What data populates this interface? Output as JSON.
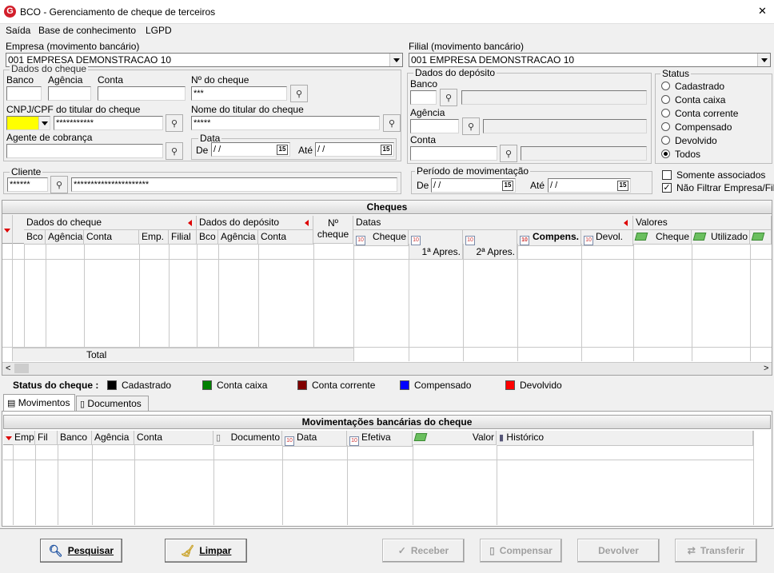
{
  "window": {
    "title": "BCO - Gerenciamento de cheque de terceiros",
    "close": "✕"
  },
  "menu": [
    "Saída",
    "Base de conhecimento",
    "LGPD"
  ],
  "empresa": {
    "label": "Empresa (movimento bancário)",
    "value": "001 EMPRESA DEMONSTRACAO 10"
  },
  "filial": {
    "label": "Filial (movimento bancário)",
    "value": "001 EMPRESA DEMONSTRACAO 10"
  },
  "dados_cheque": {
    "title": "Dados do cheque",
    "banco": "Banco",
    "agencia": "Agência",
    "conta": "Conta",
    "numero": "Nº do cheque",
    "numero_value": "***",
    "cnpj": "CNPJ/CPF do titular do cheque",
    "cnpj_value": "***********",
    "nome": "Nome do titular do cheque",
    "nome_value": "*****",
    "agente": "Agente de cobrança",
    "data": "Data",
    "de": "De",
    "ate": "Até",
    "date_placeholder": " /  /"
  },
  "dados_deposito": {
    "title": "Dados do depósito",
    "banco": "Banco",
    "agencia": "Agência",
    "conta": "Conta"
  },
  "status": {
    "title": "Status",
    "options": [
      "Cadastrado",
      "Conta caixa",
      "Conta corrente",
      "Compensado",
      "Devolvido",
      "Todos"
    ],
    "selected": "Todos"
  },
  "cliente": {
    "label": "Cliente",
    "code": "******",
    "name": "**********************"
  },
  "periodo": {
    "title": "Período de movimentação",
    "de": "De",
    "ate": "Até",
    "date_placeholder": " /  /"
  },
  "checks": {
    "somente": "Somente associados",
    "nao_filtrar": "Não Filtrar Empresa/Filial",
    "nao_filtrar_checked": true
  },
  "cheques_grid": {
    "title": "Cheques",
    "group_dados_cheque": "Dados do cheque",
    "group_dados_deposito": "Dados do depósito",
    "group_n_cheque": "Nº cheque",
    "group_datas": "Datas",
    "group_valores": "Valores",
    "cols_cheque": [
      "Bco",
      "Agência",
      "Conta",
      "Emp.",
      "Filial"
    ],
    "cols_deposito": [
      "Bco",
      "Agência",
      "Conta"
    ],
    "cols_datas": [
      "Cheque",
      "1ª Apres.",
      "2ª Apres.",
      "Compens.",
      "Devol."
    ],
    "cols_valores": [
      "Cheque",
      "Utilizado"
    ],
    "total": "Total"
  },
  "legend": {
    "label": "Status do cheque :",
    "items": [
      {
        "name": "Cadastrado",
        "color": "#000000"
      },
      {
        "name": "Conta caixa",
        "color": "#008000"
      },
      {
        "name": "Conta corrente",
        "color": "#800000"
      },
      {
        "name": "Compensado",
        "color": "#0000ff"
      },
      {
        "name": "Devolvido",
        "color": "#ff0000"
      }
    ]
  },
  "tabs": [
    "Movimentos",
    "Documentos"
  ],
  "mov_grid": {
    "title": "Movimentações bancárias do cheque",
    "cols": [
      "Emp",
      "Fil",
      "Banco",
      "Agência",
      "Conta",
      "Documento",
      "Data",
      "Efetiva",
      "Valor",
      "Histórico"
    ]
  },
  "buttons": {
    "pesquisar": "Pesquisar",
    "limpar": "Limpar",
    "receber": "Receber",
    "compensar": "Compensar",
    "devolver": "Devolver",
    "transferir": "Transferir"
  }
}
